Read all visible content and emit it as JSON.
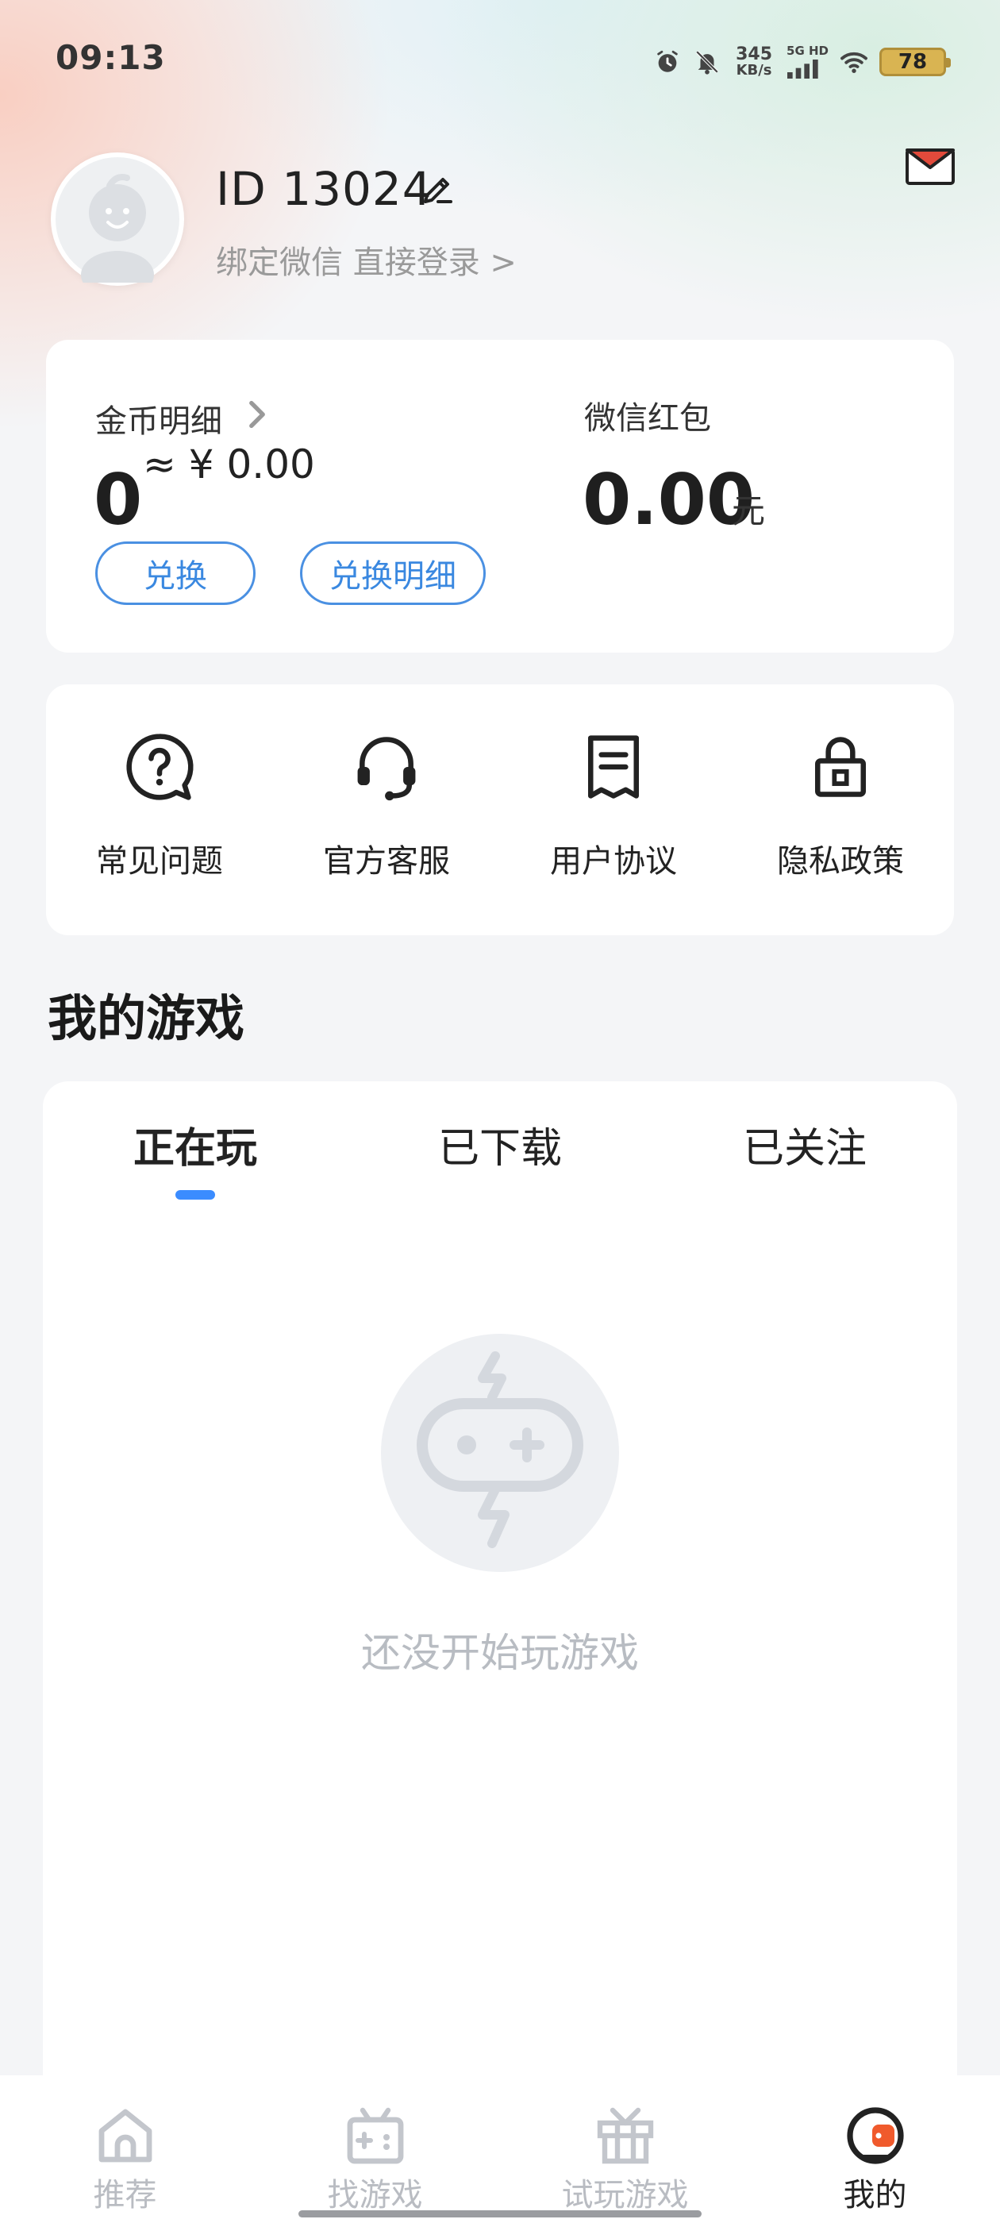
{
  "status_bar": {
    "time": "09:13",
    "net_speed_value": "345",
    "net_speed_unit": "KB/s",
    "signal_label": "5G HD",
    "battery": "78",
    "icons": [
      "alarm-icon",
      "mute-icon",
      "signal-icon",
      "wifi-icon",
      "battery-icon"
    ]
  },
  "profile": {
    "id_text": "ID 13024",
    "bind_link": "绑定微信 直接登录 >",
    "icons": [
      "avatar",
      "edit-icon",
      "mail-icon"
    ]
  },
  "wallet": {
    "coin_title": "金币明细",
    "coin_value": "0",
    "coin_approx": "≈ ¥ 0.00",
    "exchange_button": "兑换",
    "exchange_detail_button": "兑换明细",
    "wechat_title": "微信红包",
    "wechat_amount": "0.00",
    "wechat_unit": "元",
    "accent_color": "#3a88e0"
  },
  "services": [
    {
      "label": "常见问题",
      "icon": "question-icon"
    },
    {
      "label": "官方客服",
      "icon": "headset-icon"
    },
    {
      "label": "用户协议",
      "icon": "document-icon"
    },
    {
      "label": "隐私政策",
      "icon": "lock-icon"
    }
  ],
  "my_games": {
    "title": "我的游戏",
    "tabs": [
      "正在玩",
      "已下载",
      "已关注"
    ],
    "active_tab": "正在玩",
    "empty_text": "还没开始玩游戏"
  },
  "bottom_nav": {
    "items": [
      {
        "label": "推荐",
        "icon": "home-icon",
        "active": false
      },
      {
        "label": "找游戏",
        "icon": "gamepad-icon",
        "active": false
      },
      {
        "label": "试玩游戏",
        "icon": "gift-icon",
        "active": false
      },
      {
        "label": "我的",
        "icon": "profile-icon",
        "active": true
      }
    ]
  }
}
